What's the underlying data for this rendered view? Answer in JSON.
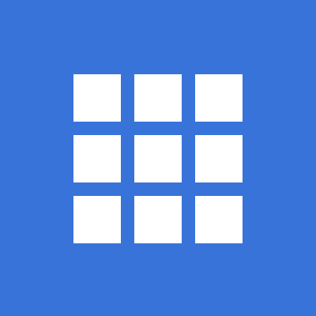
{
  "icon": {
    "name": "grid-icon",
    "background_color": "#3873DA",
    "tile_color": "#FFFFFF",
    "grid": {
      "rows": 3,
      "columns": 3
    }
  }
}
